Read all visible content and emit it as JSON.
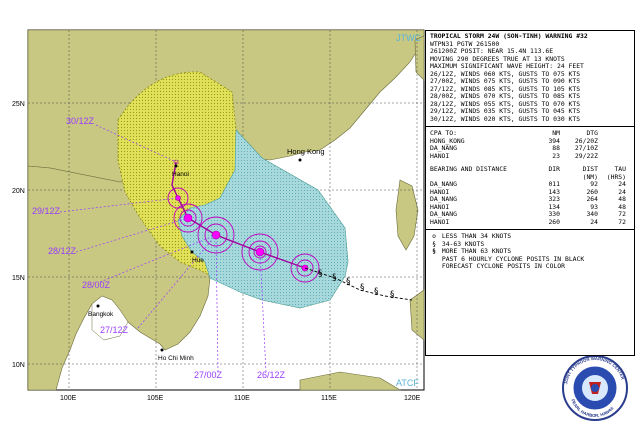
{
  "map": {
    "top_right_tag": "JTWC",
    "bottom_right_tag": "ATCF",
    "lon_labels": [
      "100E",
      "105E",
      "110E",
      "115E",
      "120E"
    ],
    "lat_labels": [
      "25N",
      "20N",
      "15N",
      "10N"
    ],
    "places": {
      "hong_kong": "Hong Kong",
      "hanoi": "Hanoi",
      "hue": "Hue",
      "bangkok": "Bangkok",
      "ho_chi_minh": "Ho Chi Minh"
    },
    "forecast_labels": [
      "30/12Z",
      "29/12Z",
      "28/12Z",
      "28/00Z",
      "27/12Z",
      "27/00Z",
      "26/12Z"
    ],
    "colors": {
      "land": "#c8c882",
      "sea": "#ffffff",
      "danger_area": "#d8d840",
      "wind_swath": "#9ed6dc",
      "track": "#a000a0",
      "label": "#9a3cff",
      "past_track": "#000000"
    }
  },
  "warning": {
    "title": "TROPICAL STORM 24W (SON-TINH) WARNING #32",
    "lines": [
      "WTPN31 PGTW 261500",
      "261200Z POSIT: NEAR 15.4N 113.6E",
      "MOVING 290 DEGREES TRUE AT 13 KNOTS",
      "MAXIMUM SIGNIFICANT WAVE HEIGHT: 24 FEET",
      "26/12Z, WINDS 060 KTS, GUSTS TO 075 KTS",
      "27/00Z, WINDS 075 KTS, GUSTS TO 090 KTS",
      "27/12Z, WINDS 085 KTS, GUSTS TO 105 KTS",
      "28/00Z, WINDS 070 KTS, GUSTS TO 085 KTS",
      "28/12Z, WINDS 055 KTS, GUSTS TO 070 KTS",
      "29/12Z, WINDS 035 KTS, GUSTS TO 045 KTS",
      "30/12Z, WINDS 020 KTS, GUSTS TO 030 KTS"
    ],
    "cpa": {
      "headers": [
        "CPA TO:",
        "NM",
        "DTG"
      ],
      "rows": [
        [
          "HONG_KONG",
          "394",
          "26/20Z"
        ],
        [
          "DA_NANG",
          "88",
          "27/10Z"
        ],
        [
          "HANOI",
          "23",
          "29/22Z"
        ]
      ]
    },
    "bearing": {
      "headers": [
        "BEARING AND DISTANCE",
        "DIR",
        "DIST",
        "TAU"
      ],
      "subheaders": [
        "(NM)",
        "(HRS)"
      ],
      "rows": [
        [
          "DA_NANG",
          "011",
          "92",
          "24"
        ],
        [
          "HANOI",
          "143",
          "260",
          "24"
        ],
        [
          "DA_NANG",
          "323",
          "264",
          "48"
        ],
        [
          "HANOI",
          "134",
          "93",
          "48"
        ],
        [
          "DA_NANG",
          "330",
          "340",
          "72"
        ],
        [
          "HANOI",
          "260",
          "24",
          "72"
        ]
      ]
    },
    "legend": [
      {
        "symbol": "o",
        "text": "LESS THAN 34 KNOTS"
      },
      {
        "symbol": "§",
        "text": "34-63 KNOTS"
      },
      {
        "symbol": "§",
        "text": "MORE THAN 63 KNOTS"
      },
      {
        "symbol": "",
        "text": "PAST 6 HOURLY CYCLONE POSITS IN BLACK"
      },
      {
        "symbol": "",
        "text": "FORECAST CYCLONE POSITS IN COLOR"
      }
    ]
  },
  "seal": {
    "outer_text": "JOINT TYPHOON WARNING CENTER",
    "bottom_text": "PEARL HARBOR, HAWAII"
  }
}
